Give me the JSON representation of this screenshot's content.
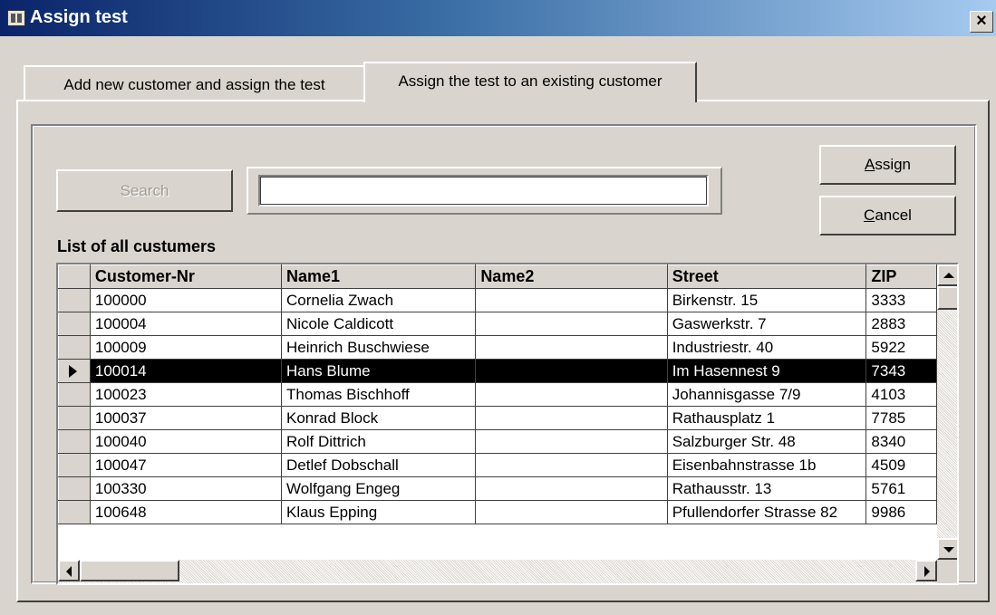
{
  "window": {
    "title": "Assign test",
    "close_label": "×"
  },
  "tabs": [
    {
      "label": "Add new customer and assign the test"
    },
    {
      "label": "Assign the test to an existing customer"
    }
  ],
  "search": {
    "button_label": "Search",
    "input_value": ""
  },
  "buttons": {
    "assign_label": "Assign",
    "assign_accel": "A",
    "assign_rest": "ssign",
    "cancel_label": "Cancel",
    "cancel_accel": "C",
    "cancel_rest": "ancel"
  },
  "list": {
    "label": "List of all custumers",
    "columns": [
      "Customer-Nr",
      "Name1",
      "Name2",
      "Street",
      "ZIP"
    ],
    "selected_row": 3,
    "rows": [
      [
        "100000",
        "Cornelia Zwach",
        "",
        "Birkenstr. 15",
        "3333"
      ],
      [
        "100004",
        "Nicole Caldicott",
        "",
        "Gaswerkstr. 7",
        "2883"
      ],
      [
        "100009",
        "Heinrich Buschwiese",
        "",
        "Industriestr. 40",
        "5922"
      ],
      [
        "100014",
        "Hans Blume",
        "",
        "Im Hasennest 9",
        "7343"
      ],
      [
        "100023",
        "Thomas Bischhoff",
        "",
        "Johannisgasse 7/9",
        "4103"
      ],
      [
        "100037",
        "Konrad Block",
        "",
        "Rathausplatz 1",
        "7785"
      ],
      [
        "100040",
        "Rolf Dittrich",
        "",
        "Salzburger Str. 48",
        "8340"
      ],
      [
        "100047",
        "Detlef Dobschall",
        "",
        "Eisenbahnstrasse 1b",
        "4509"
      ],
      [
        "100330",
        "Wolfgang Engeg",
        "",
        "Rathausstr. 13",
        "5761"
      ],
      [
        "100648",
        "Klaus Epping",
        "",
        "Pfullendorfer Strasse 82",
        "9986"
      ]
    ]
  }
}
